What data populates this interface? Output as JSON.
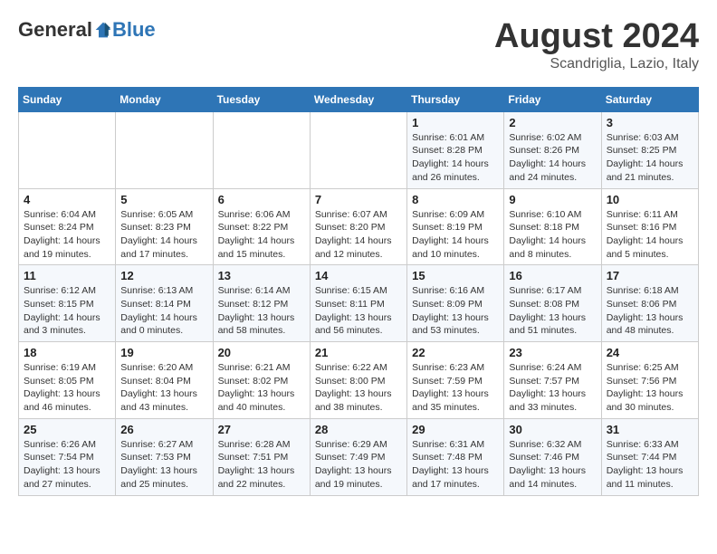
{
  "logo": {
    "general": "General",
    "blue": "Blue"
  },
  "title": "August 2024",
  "subtitle": "Scandriglia, Lazio, Italy",
  "days_of_week": [
    "Sunday",
    "Monday",
    "Tuesday",
    "Wednesday",
    "Thursday",
    "Friday",
    "Saturday"
  ],
  "weeks": [
    [
      {
        "day": "",
        "info": ""
      },
      {
        "day": "",
        "info": ""
      },
      {
        "day": "",
        "info": ""
      },
      {
        "day": "",
        "info": ""
      },
      {
        "day": "1",
        "info": "Sunrise: 6:01 AM\nSunset: 8:28 PM\nDaylight: 14 hours and 26 minutes."
      },
      {
        "day": "2",
        "info": "Sunrise: 6:02 AM\nSunset: 8:26 PM\nDaylight: 14 hours and 24 minutes."
      },
      {
        "day": "3",
        "info": "Sunrise: 6:03 AM\nSunset: 8:25 PM\nDaylight: 14 hours and 21 minutes."
      }
    ],
    [
      {
        "day": "4",
        "info": "Sunrise: 6:04 AM\nSunset: 8:24 PM\nDaylight: 14 hours and 19 minutes."
      },
      {
        "day": "5",
        "info": "Sunrise: 6:05 AM\nSunset: 8:23 PM\nDaylight: 14 hours and 17 minutes."
      },
      {
        "day": "6",
        "info": "Sunrise: 6:06 AM\nSunset: 8:22 PM\nDaylight: 14 hours and 15 minutes."
      },
      {
        "day": "7",
        "info": "Sunrise: 6:07 AM\nSunset: 8:20 PM\nDaylight: 14 hours and 12 minutes."
      },
      {
        "day": "8",
        "info": "Sunrise: 6:09 AM\nSunset: 8:19 PM\nDaylight: 14 hours and 10 minutes."
      },
      {
        "day": "9",
        "info": "Sunrise: 6:10 AM\nSunset: 8:18 PM\nDaylight: 14 hours and 8 minutes."
      },
      {
        "day": "10",
        "info": "Sunrise: 6:11 AM\nSunset: 8:16 PM\nDaylight: 14 hours and 5 minutes."
      }
    ],
    [
      {
        "day": "11",
        "info": "Sunrise: 6:12 AM\nSunset: 8:15 PM\nDaylight: 14 hours and 3 minutes."
      },
      {
        "day": "12",
        "info": "Sunrise: 6:13 AM\nSunset: 8:14 PM\nDaylight: 14 hours and 0 minutes."
      },
      {
        "day": "13",
        "info": "Sunrise: 6:14 AM\nSunset: 8:12 PM\nDaylight: 13 hours and 58 minutes."
      },
      {
        "day": "14",
        "info": "Sunrise: 6:15 AM\nSunset: 8:11 PM\nDaylight: 13 hours and 56 minutes."
      },
      {
        "day": "15",
        "info": "Sunrise: 6:16 AM\nSunset: 8:09 PM\nDaylight: 13 hours and 53 minutes."
      },
      {
        "day": "16",
        "info": "Sunrise: 6:17 AM\nSunset: 8:08 PM\nDaylight: 13 hours and 51 minutes."
      },
      {
        "day": "17",
        "info": "Sunrise: 6:18 AM\nSunset: 8:06 PM\nDaylight: 13 hours and 48 minutes."
      }
    ],
    [
      {
        "day": "18",
        "info": "Sunrise: 6:19 AM\nSunset: 8:05 PM\nDaylight: 13 hours and 46 minutes."
      },
      {
        "day": "19",
        "info": "Sunrise: 6:20 AM\nSunset: 8:04 PM\nDaylight: 13 hours and 43 minutes."
      },
      {
        "day": "20",
        "info": "Sunrise: 6:21 AM\nSunset: 8:02 PM\nDaylight: 13 hours and 40 minutes."
      },
      {
        "day": "21",
        "info": "Sunrise: 6:22 AM\nSunset: 8:00 PM\nDaylight: 13 hours and 38 minutes."
      },
      {
        "day": "22",
        "info": "Sunrise: 6:23 AM\nSunset: 7:59 PM\nDaylight: 13 hours and 35 minutes."
      },
      {
        "day": "23",
        "info": "Sunrise: 6:24 AM\nSunset: 7:57 PM\nDaylight: 13 hours and 33 minutes."
      },
      {
        "day": "24",
        "info": "Sunrise: 6:25 AM\nSunset: 7:56 PM\nDaylight: 13 hours and 30 minutes."
      }
    ],
    [
      {
        "day": "25",
        "info": "Sunrise: 6:26 AM\nSunset: 7:54 PM\nDaylight: 13 hours and 27 minutes."
      },
      {
        "day": "26",
        "info": "Sunrise: 6:27 AM\nSunset: 7:53 PM\nDaylight: 13 hours and 25 minutes."
      },
      {
        "day": "27",
        "info": "Sunrise: 6:28 AM\nSunset: 7:51 PM\nDaylight: 13 hours and 22 minutes."
      },
      {
        "day": "28",
        "info": "Sunrise: 6:29 AM\nSunset: 7:49 PM\nDaylight: 13 hours and 19 minutes."
      },
      {
        "day": "29",
        "info": "Sunrise: 6:31 AM\nSunset: 7:48 PM\nDaylight: 13 hours and 17 minutes."
      },
      {
        "day": "30",
        "info": "Sunrise: 6:32 AM\nSunset: 7:46 PM\nDaylight: 13 hours and 14 minutes."
      },
      {
        "day": "31",
        "info": "Sunrise: 6:33 AM\nSunset: 7:44 PM\nDaylight: 13 hours and 11 minutes."
      }
    ]
  ]
}
